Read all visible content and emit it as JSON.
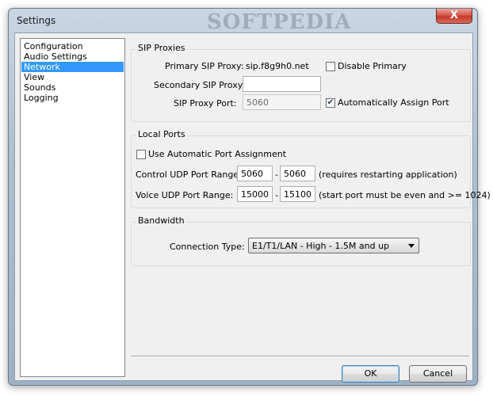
{
  "window": {
    "title": "Settings",
    "close_label": "X",
    "watermark": "SOFTPEDIA"
  },
  "sidebar": {
    "items": [
      {
        "label": "Configuration",
        "selected": false
      },
      {
        "label": "Audio Settings",
        "selected": false
      },
      {
        "label": "Network",
        "selected": true
      },
      {
        "label": "View",
        "selected": false
      },
      {
        "label": "Sounds",
        "selected": false
      },
      {
        "label": "Logging",
        "selected": false
      }
    ]
  },
  "sip_proxies": {
    "legend": "SIP Proxies",
    "primary_label": "Primary SIP Proxy:",
    "primary_value": "sip.f8g9h0.net",
    "disable_primary_label": "Disable Primary",
    "disable_primary_checked": false,
    "secondary_label": "Secondary SIP Proxy:",
    "secondary_value": "",
    "port_label": "SIP Proxy Port:",
    "port_value": "5060",
    "auto_assign_label": "Automatically Assign Port",
    "auto_assign_checked": true
  },
  "local_ports": {
    "legend": "Local Ports",
    "auto_port_label": "Use Automatic Port Assignment",
    "auto_port_checked": false,
    "control_label": "Control UDP Port Range:",
    "control_from": "5060",
    "control_to": "5060",
    "range_dash": "-",
    "control_note": "(requires restarting application)",
    "voice_label": "Voice UDP Port Range:",
    "voice_from": "15000",
    "voice_to": "15100",
    "voice_note": "(start port must be even and >= 1024)"
  },
  "bandwidth": {
    "legend": "Bandwidth",
    "connection_label": "Connection Type:",
    "connection_value": "E1/T1/LAN - High - 1.5M and up"
  },
  "buttons": {
    "ok": "OK",
    "cancel": "Cancel"
  },
  "checkmark": "✔"
}
